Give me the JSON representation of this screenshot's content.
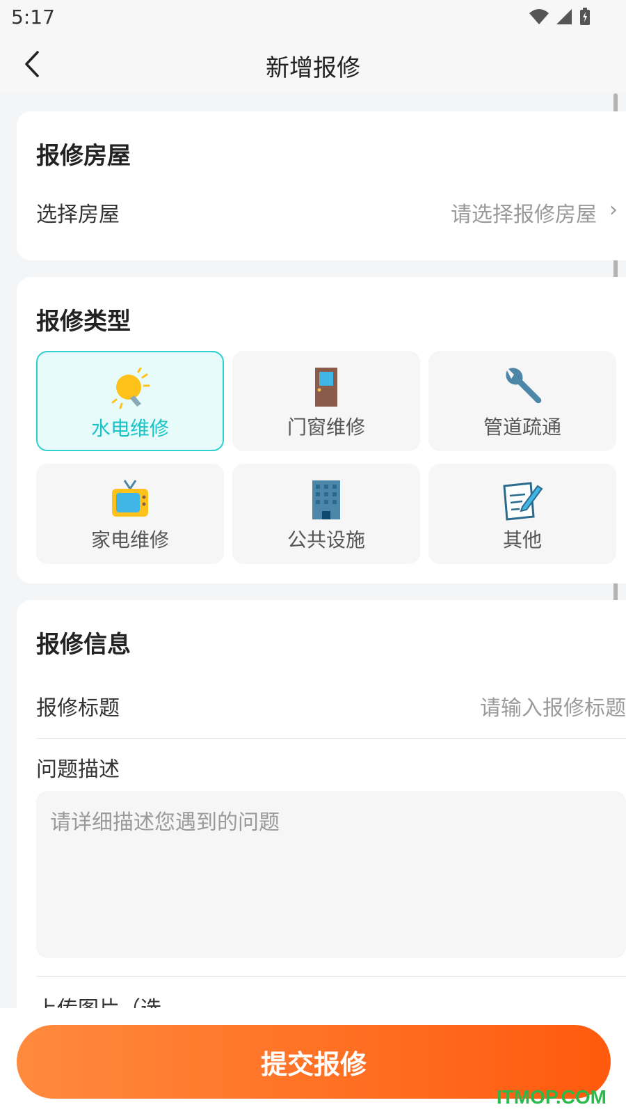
{
  "status_bar": {
    "time": "5:17"
  },
  "nav": {
    "title": "新增报修"
  },
  "house_card": {
    "title": "报修房屋",
    "select_label": "选择房屋",
    "select_placeholder": "请选择报修房屋"
  },
  "type_card": {
    "title": "报修类型",
    "types": [
      {
        "label": "水电维修",
        "icon": "bulb-icon",
        "selected": true
      },
      {
        "label": "门窗维修",
        "icon": "door-icon",
        "selected": false
      },
      {
        "label": "管道疏通",
        "icon": "wrench-icon",
        "selected": false
      },
      {
        "label": "家电维修",
        "icon": "tv-icon",
        "selected": false
      },
      {
        "label": "公共设施",
        "icon": "building-icon",
        "selected": false
      },
      {
        "label": "其他",
        "icon": "note-icon",
        "selected": false
      }
    ]
  },
  "info_card": {
    "title": "报修信息",
    "title_label": "报修标题",
    "title_placeholder": "请输入报修标题",
    "desc_label": "问题描述",
    "desc_placeholder": "请详细描述您遇到的问题",
    "upload_label": "上传图片（选"
  },
  "submit_label": "提交报修",
  "watermark": "ITMOP.COM",
  "colors": {
    "accent": "#2fcfd0",
    "submit_start": "#ff8a3d",
    "submit_end": "#ff5a0e"
  }
}
